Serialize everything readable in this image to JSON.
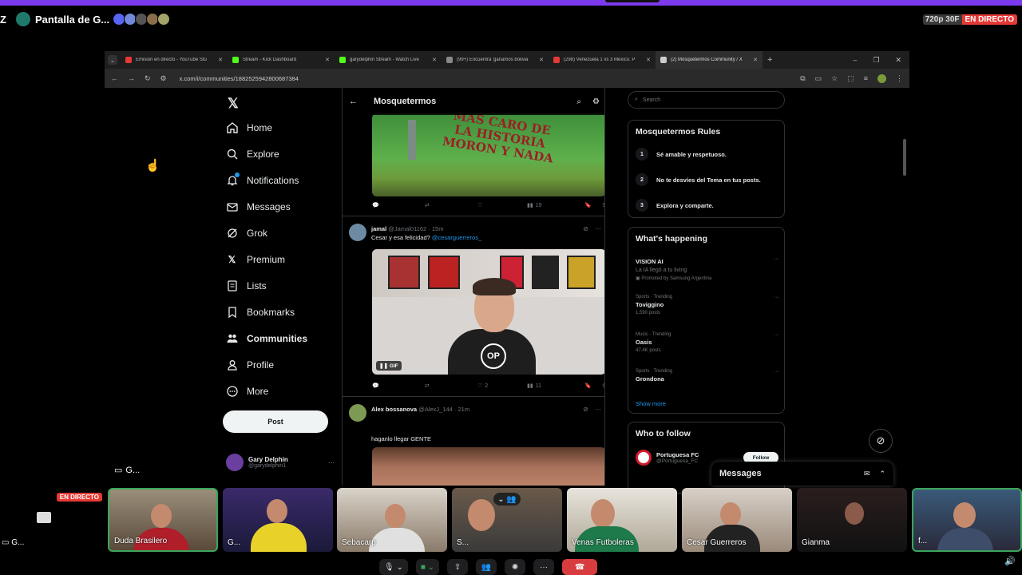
{
  "discord": {
    "server_letter": "Z",
    "stream_title": "Pantalla de G...",
    "quality": "720p 30F",
    "live_badge": "EN DIRECTO",
    "screen_label": "G...",
    "self_label": "G..."
  },
  "browser": {
    "tabs": [
      {
        "title": "Emisión en directo - YouTube Stu",
        "color": "#e53935"
      },
      {
        "title": "Stream - Kick Dashboard",
        "color": "#53fc18"
      },
      {
        "title": "garydelphin Stream - Watch Live",
        "color": "#53fc18"
      },
      {
        "title": "(99+) Encuentra 'ganamos bolivia",
        "color": "#888888"
      },
      {
        "title": "(298) Venezuela 1 vs 3 Mexico. P",
        "color": "#e53935"
      },
      {
        "title": "(2) Mosquetermos Community / X",
        "color": "#cccccc"
      }
    ],
    "url": "x.com/i/communities/1882525942800687384"
  },
  "x_nav": {
    "items": [
      {
        "label": "Home",
        "icon": "home-icon"
      },
      {
        "label": "Explore",
        "icon": "search-icon"
      },
      {
        "label": "Notifications",
        "icon": "bell-icon"
      },
      {
        "label": "Messages",
        "icon": "mail-icon"
      },
      {
        "label": "Grok",
        "icon": "grok-icon"
      },
      {
        "label": "Premium",
        "icon": "x-icon"
      },
      {
        "label": "Lists",
        "icon": "list-icon"
      },
      {
        "label": "Bookmarks",
        "icon": "bookmark-icon"
      },
      {
        "label": "Communities",
        "icon": "communities-icon"
      },
      {
        "label": "Profile",
        "icon": "profile-icon"
      },
      {
        "label": "More",
        "icon": "more-icon"
      }
    ],
    "post_label": "Post",
    "account_name": "Gary Delphin",
    "account_handle": "@garydelphin1"
  },
  "feed": {
    "title": "Mosquetermos",
    "post1": {
      "graffiti": "MAS CARO DE\nLA HISTORIA\nMORON Y NADA",
      "views": "19"
    },
    "post2": {
      "name": "jamal",
      "handle_time": "@Jamal01162 · 15m",
      "text": "Cesar y esa felicidad?",
      "mention": "@cesarguerreros_",
      "gif_label": "GIF",
      "logo": "OP",
      "likes": "2",
      "views": "11"
    },
    "post3": {
      "name": "Alex bossanova",
      "handle_time": "@AlexJ_144 · 21m",
      "text": "haganlo llegar GENTE"
    }
  },
  "right": {
    "search_placeholder": "Search",
    "rules_title": "Mosquetermos Rules",
    "rules": [
      {
        "n": "1",
        "text": "Sé amable y respetuoso."
      },
      {
        "n": "2",
        "text": "No te desvíes del Tema en tus posts."
      },
      {
        "n": "3",
        "text": "Explora y comparte."
      }
    ],
    "happening_title": "What's happening",
    "trends": [
      {
        "cat": "",
        "name": "VISION AI",
        "sub": "La IA llegó a tu living",
        "promo": "Promoted by Samsung Argentina"
      },
      {
        "cat": "Sports · Trending",
        "name": "Toviggino",
        "sub": "1,590 posts",
        "promo": ""
      },
      {
        "cat": "Music · Trending",
        "name": "Oasis",
        "sub": "47.4K posts",
        "promo": ""
      },
      {
        "cat": "Sports · Trending",
        "name": "Grondona",
        "sub": "",
        "promo": ""
      }
    ],
    "show_more": "Show more",
    "follow_title": "Who to follow",
    "follow": {
      "name": "Portuguesa FC",
      "handle": "@Portuguesa_FC",
      "button": "Follow"
    },
    "messages_title": "Messages"
  },
  "participants": [
    {
      "label": "",
      "live": "EN DIRECTO"
    },
    {
      "label": "Duda Brasilero"
    },
    {
      "label": "G..."
    },
    {
      "label": "Sebacarp"
    },
    {
      "label": "S..."
    },
    {
      "label": "Venas Futboleras"
    },
    {
      "label": "Cesar Guerreros"
    },
    {
      "label": "Gianma"
    },
    {
      "label": "f..."
    }
  ]
}
